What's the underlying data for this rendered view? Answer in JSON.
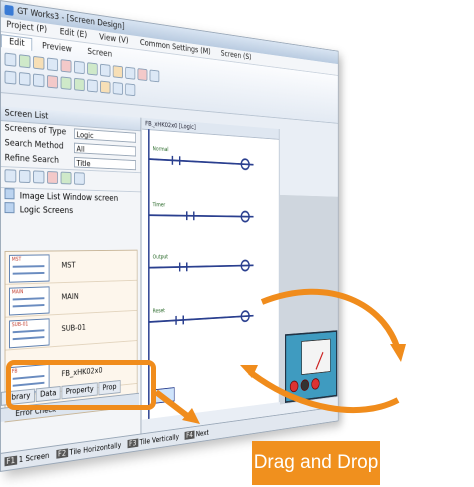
{
  "app": {
    "title": "GT Works3 - [Screen Design]"
  },
  "menubar": [
    "Project (P)",
    "Edit (E)",
    "View (V)",
    "Common Settings (M)",
    "Screen (S)"
  ],
  "ribbon": {
    "tabs": [
      "Edit",
      "Preview",
      "Screen"
    ],
    "active_tab": "Edit"
  },
  "left_panel": {
    "title": "Screen List",
    "filters": [
      {
        "label": "Screens of Type",
        "value": "Logic"
      },
      {
        "label": "Search Method",
        "value": "All"
      },
      {
        "label": "Refine Search",
        "value": "Title"
      }
    ],
    "tree": [
      {
        "label": "Image List Window screen"
      },
      {
        "label": "Logic Screens"
      }
    ],
    "items": [
      {
        "tag": "MST",
        "name": "MST"
      },
      {
        "tag": "MAIN",
        "name": "MAIN"
      },
      {
        "tag": "SUB-01",
        "name": "SUB-01"
      },
      {
        "tag": "FB",
        "name": "FB_xHK02x0"
      }
    ],
    "bottom_tabs": [
      "Library",
      "Data",
      "Property",
      "Prop"
    ],
    "error_check": "Error Check"
  },
  "statusbar": [
    {
      "key": "F1",
      "label": "1 Screen"
    },
    {
      "key": "F2",
      "label": "Tile Horizontally"
    },
    {
      "key": "F3",
      "label": "Tile Vertically"
    },
    {
      "key": "F4",
      "label": "Next"
    }
  ],
  "editor": {
    "tab": "FB_xHK02x0 [Logic]",
    "rung_labels": [
      "Normal",
      "Timer",
      "Output",
      "Reset"
    ]
  },
  "callout": {
    "label": "Drag and Drop",
    "color": "#f0901e"
  }
}
